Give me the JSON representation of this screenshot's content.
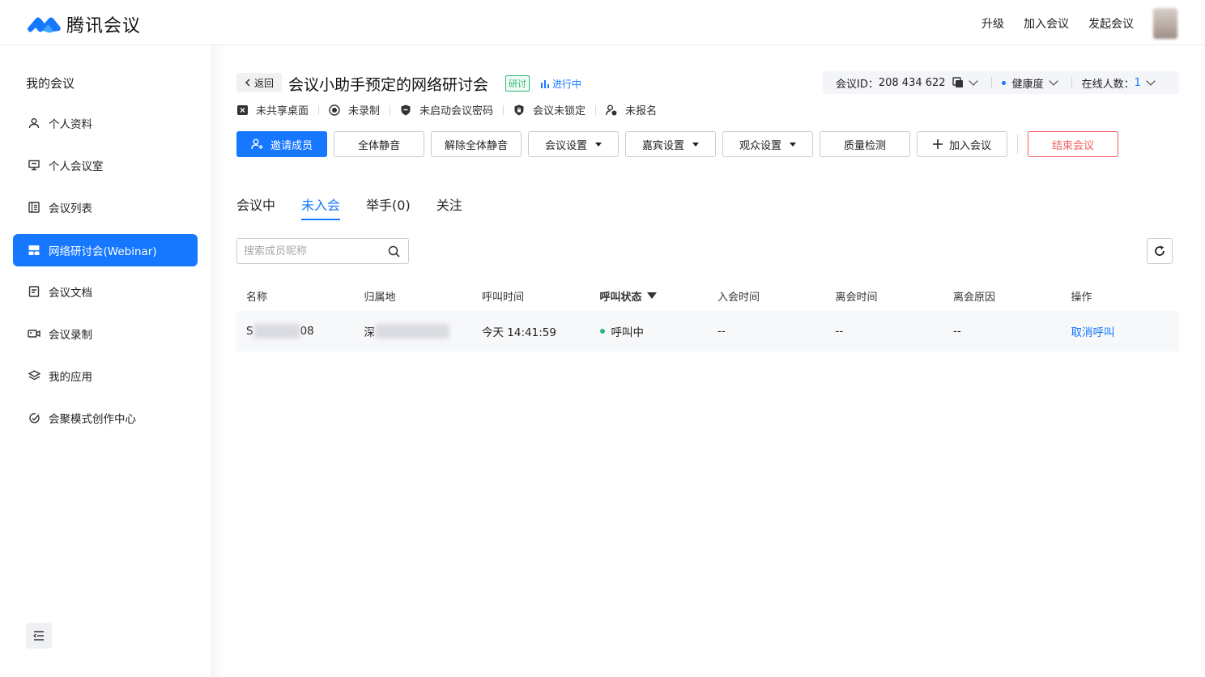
{
  "app": {
    "name": "腾讯会议"
  },
  "top_nav": {
    "upgrade": "升级",
    "join": "加入会议",
    "start": "发起会议"
  },
  "sidebar": {
    "title": "我的会议",
    "items": [
      {
        "label": "个人资料",
        "icon": "user-icon"
      },
      {
        "label": "个人会议室",
        "icon": "monitor-icon"
      },
      {
        "label": "会议列表",
        "icon": "list-icon"
      },
      {
        "label": "网络研讨会(Webinar)",
        "icon": "webinar-icon"
      },
      {
        "label": "会议文档",
        "icon": "document-icon"
      },
      {
        "label": "会议录制",
        "icon": "video-icon"
      },
      {
        "label": "我的应用",
        "icon": "layers-icon"
      },
      {
        "label": "会聚模式创作中心",
        "icon": "creator-icon"
      }
    ]
  },
  "meeting": {
    "back_label": "返回",
    "title": "会议小助手预定的网络研讨会",
    "type_tag": "研讨",
    "live_status": "进行中",
    "id_label": "会议ID：",
    "id_value": "208 434 622",
    "health_label": "健康度",
    "online_label": "在线人数：",
    "online_count": "1"
  },
  "status_row": [
    {
      "label": "未共享桌面",
      "icon": "screen-share-off-icon"
    },
    {
      "label": "未录制",
      "icon": "record-icon"
    },
    {
      "label": "未启动会议密码",
      "icon": "shield-icon"
    },
    {
      "label": "会议未锁定",
      "icon": "lock-shield-icon"
    },
    {
      "label": "未报名",
      "icon": "registration-icon"
    }
  ],
  "actions": {
    "invite": "邀请成员",
    "mute_all": "全体静音",
    "unmute_all": "解除全体静音",
    "meeting_settings": "会议设置",
    "guest_settings": "嘉宾设置",
    "audience_settings": "观众设置",
    "quality_check": "质量检测",
    "join_meeting": "加入会议",
    "end_meeting": "结束会议"
  },
  "tabs": [
    {
      "label": "会议中"
    },
    {
      "label": "未入会"
    },
    {
      "label": "举手(0)"
    },
    {
      "label": "关注"
    }
  ],
  "search": {
    "placeholder": "搜索成员昵称"
  },
  "table": {
    "headers": [
      "名称",
      "归属地",
      "呼叫时间",
      "呼叫状态",
      "入会时间",
      "离会时间",
      "离会原因",
      "操作"
    ],
    "rows": [
      {
        "name_prefix": "S",
        "name_suffix": "08",
        "location_prefix": "深",
        "call_time": "今天 14:41:59",
        "call_status": "呼叫中",
        "join_time": "--",
        "leave_time": "--",
        "leave_reason": "--",
        "action": "取消呼叫"
      }
    ]
  },
  "colors": {
    "accent": "#1677ff",
    "danger": "#f15b5b",
    "success": "#2bb673"
  }
}
